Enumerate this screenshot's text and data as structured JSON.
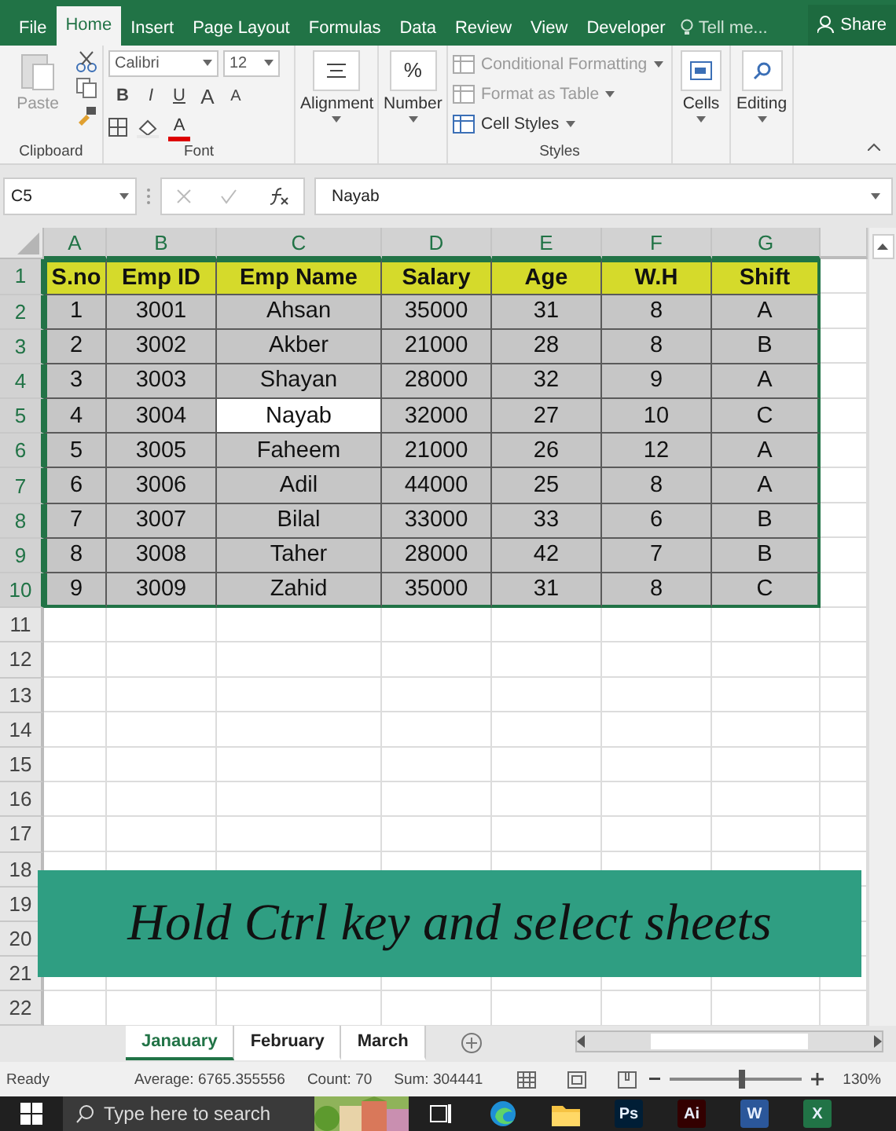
{
  "ribbon_tabs": [
    {
      "label": "File",
      "selected": false
    },
    {
      "label": "Home",
      "selected": true
    },
    {
      "label": "Insert",
      "selected": false
    },
    {
      "label": "Page Layout",
      "selected": false
    },
    {
      "label": "Formulas",
      "selected": false
    },
    {
      "label": "Data",
      "selected": false
    },
    {
      "label": "Review",
      "selected": false
    },
    {
      "label": "View",
      "selected": false
    },
    {
      "label": "Developer",
      "selected": false
    }
  ],
  "tell_me": "Tell me...",
  "share": "Share",
  "ribbon": {
    "clipboard": {
      "paste": "Paste",
      "label": "Clipboard"
    },
    "font": {
      "name": "Calibri",
      "size": "12",
      "bold": "B",
      "italic": "I",
      "underline": "U",
      "grow": "A",
      "shrink": "A",
      "color_letter": "A",
      "label": "Font"
    },
    "alignment": {
      "label": "Alignment"
    },
    "number": {
      "label": "Number",
      "symbol": "%"
    },
    "styles": {
      "items": [
        {
          "label": "Conditional Formatting",
          "disabled": true
        },
        {
          "label": "Format as Table",
          "disabled": true
        },
        {
          "label": "Cell Styles",
          "disabled": false
        }
      ],
      "label": "Styles"
    },
    "cells": {
      "label": "Cells"
    },
    "editing": {
      "label": "Editing"
    }
  },
  "formula_bar": {
    "name_box": "C5",
    "formula": "Nayab"
  },
  "columns": [
    {
      "label": "A",
      "highlighted": true
    },
    {
      "label": "B",
      "highlighted": true
    },
    {
      "label": "C",
      "highlighted": true
    },
    {
      "label": "D",
      "highlighted": true
    },
    {
      "label": "E",
      "highlighted": true
    },
    {
      "label": "F",
      "highlighted": true
    },
    {
      "label": "G",
      "highlighted": true
    }
  ],
  "rows": [
    {
      "number": "1",
      "kind": "header",
      "highlighted": true,
      "cells": [
        {
          "value": "S.no",
          "selected": false
        },
        {
          "value": "Emp ID",
          "selected": false
        },
        {
          "value": "Emp Name",
          "selected": false
        },
        {
          "value": "Salary",
          "selected": false
        },
        {
          "value": "Age",
          "selected": false
        },
        {
          "value": "W.H",
          "selected": false
        },
        {
          "value": "Shift",
          "selected": false
        }
      ]
    },
    {
      "number": "2",
      "kind": "data",
      "highlighted": true,
      "cells": [
        {
          "value": "1",
          "selected": false
        },
        {
          "value": "3001",
          "selected": false
        },
        {
          "value": "Ahsan",
          "selected": false
        },
        {
          "value": "35000",
          "selected": false
        },
        {
          "value": "31",
          "selected": false
        },
        {
          "value": "8",
          "selected": false
        },
        {
          "value": "A",
          "selected": false
        }
      ]
    },
    {
      "number": "3",
      "kind": "data",
      "highlighted": true,
      "cells": [
        {
          "value": "2",
          "selected": false
        },
        {
          "value": "3002",
          "selected": false
        },
        {
          "value": "Akber",
          "selected": false
        },
        {
          "value": "21000",
          "selected": false
        },
        {
          "value": "28",
          "selected": false
        },
        {
          "value": "8",
          "selected": false
        },
        {
          "value": "B",
          "selected": false
        }
      ]
    },
    {
      "number": "4",
      "kind": "data",
      "highlighted": true,
      "cells": [
        {
          "value": "3",
          "selected": false
        },
        {
          "value": "3003",
          "selected": false
        },
        {
          "value": "Shayan",
          "selected": false
        },
        {
          "value": "28000",
          "selected": false
        },
        {
          "value": "32",
          "selected": false
        },
        {
          "value": "9",
          "selected": false
        },
        {
          "value": "A",
          "selected": false
        }
      ]
    },
    {
      "number": "5",
      "kind": "data",
      "highlighted": true,
      "cells": [
        {
          "value": "4",
          "selected": false
        },
        {
          "value": "3004",
          "selected": false
        },
        {
          "value": "Nayab",
          "selected": true
        },
        {
          "value": "32000",
          "selected": false
        },
        {
          "value": "27",
          "selected": false
        },
        {
          "value": "10",
          "selected": false
        },
        {
          "value": "C",
          "selected": false
        }
      ]
    },
    {
      "number": "6",
      "kind": "data",
      "highlighted": true,
      "cells": [
        {
          "value": "5",
          "selected": false
        },
        {
          "value": "3005",
          "selected": false
        },
        {
          "value": "Faheem",
          "selected": false
        },
        {
          "value": "21000",
          "selected": false
        },
        {
          "value": "26",
          "selected": false
        },
        {
          "value": "12",
          "selected": false
        },
        {
          "value": "A",
          "selected": false
        }
      ]
    },
    {
      "number": "7",
      "kind": "data",
      "highlighted": true,
      "cells": [
        {
          "value": "6",
          "selected": false
        },
        {
          "value": "3006",
          "selected": false
        },
        {
          "value": "Adil",
          "selected": false
        },
        {
          "value": "44000",
          "selected": false
        },
        {
          "value": "25",
          "selected": false
        },
        {
          "value": "8",
          "selected": false
        },
        {
          "value": "A",
          "selected": false
        }
      ]
    },
    {
      "number": "8",
      "kind": "data",
      "highlighted": true,
      "cells": [
        {
          "value": "7",
          "selected": false
        },
        {
          "value": "3007",
          "selected": false
        },
        {
          "value": "Bilal",
          "selected": false
        },
        {
          "value": "33000",
          "selected": false
        },
        {
          "value": "33",
          "selected": false
        },
        {
          "value": "6",
          "selected": false
        },
        {
          "value": "B",
          "selected": false
        }
      ]
    },
    {
      "number": "9",
      "kind": "data",
      "highlighted": true,
      "cells": [
        {
          "value": "8",
          "selected": false
        },
        {
          "value": "3008",
          "selected": false
        },
        {
          "value": "Taher",
          "selected": false
        },
        {
          "value": "28000",
          "selected": false
        },
        {
          "value": "42",
          "selected": false
        },
        {
          "value": "7",
          "selected": false
        },
        {
          "value": "B",
          "selected": false
        }
      ]
    },
    {
      "number": "10",
      "kind": "data",
      "highlighted": true,
      "cells": [
        {
          "value": "9",
          "selected": false
        },
        {
          "value": "3009",
          "selected": false
        },
        {
          "value": "Zahid",
          "selected": false
        },
        {
          "value": "35000",
          "selected": false
        },
        {
          "value": "31",
          "selected": false
        },
        {
          "value": "8",
          "selected": false
        },
        {
          "value": "C",
          "selected": false
        }
      ]
    },
    {
      "number": "11",
      "kind": "empty",
      "highlighted": false,
      "cells": []
    },
    {
      "number": "12",
      "kind": "empty",
      "highlighted": false,
      "cells": []
    },
    {
      "number": "13",
      "kind": "empty",
      "highlighted": false,
      "cells": []
    },
    {
      "number": "14",
      "kind": "empty",
      "highlighted": false,
      "cells": []
    },
    {
      "number": "15",
      "kind": "empty",
      "highlighted": false,
      "cells": []
    },
    {
      "number": "16",
      "kind": "empty",
      "highlighted": false,
      "cells": []
    },
    {
      "number": "17",
      "kind": "empty",
      "highlighted": false,
      "cells": []
    },
    {
      "number": "18",
      "kind": "empty",
      "highlighted": false,
      "cells": []
    },
    {
      "number": "19",
      "kind": "empty",
      "highlighted": false,
      "cells": []
    },
    {
      "number": "20",
      "kind": "empty",
      "highlighted": false,
      "cells": []
    },
    {
      "number": "21",
      "kind": "empty",
      "highlighted": false,
      "cells": []
    },
    {
      "number": "22",
      "kind": "empty",
      "highlighted": false,
      "cells": []
    }
  ],
  "caption": "Hold Ctrl key and select sheets",
  "sheets": [
    {
      "label": "Janauary",
      "selected": true
    },
    {
      "label": "February",
      "selected": false
    },
    {
      "label": "March",
      "selected": false
    }
  ],
  "status_bar": {
    "ready": "Ready",
    "average": "Average: 6765.355556",
    "count": "Count: 70",
    "sum": "Sum: 304441",
    "zoom": "130%",
    "zoom_level": {
      "level": 0.55
    }
  },
  "taskbar": {
    "search_placeholder": "Type here to search",
    "apps": [
      {
        "kind": "task-view"
      },
      {
        "kind": "browser"
      },
      {
        "kind": "folder"
      },
      {
        "kind": "letter",
        "label": "Ps",
        "color": "#001e36"
      },
      {
        "kind": "letter",
        "label": "Ai",
        "color": "#330000"
      },
      {
        "kind": "letter",
        "label": "W",
        "color": "#2b579a"
      },
      {
        "kind": "letter",
        "label": "X",
        "color": "#217346"
      }
    ]
  }
}
